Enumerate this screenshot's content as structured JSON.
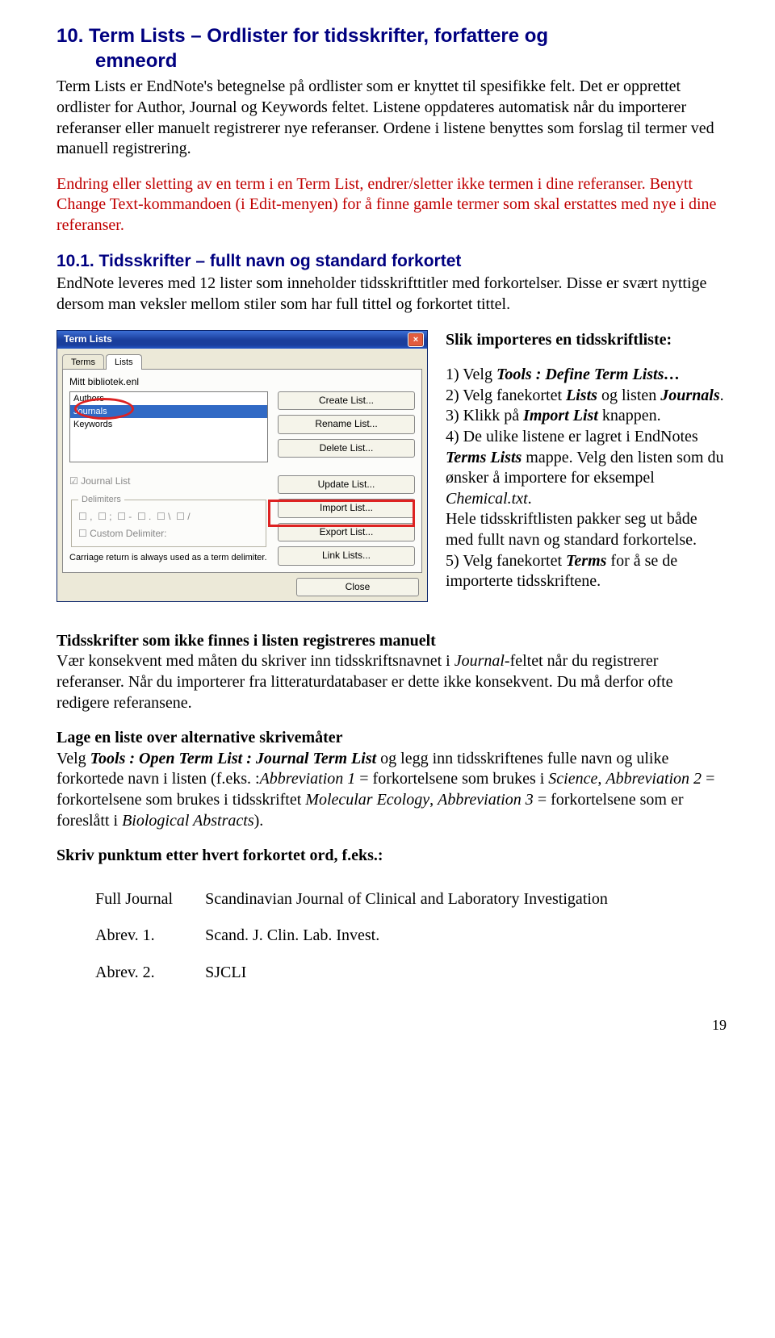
{
  "h1_line1": "10. Term Lists – Ordlister for tidsskrifter, forfattere og",
  "h1_line2": "emneord",
  "para_intro": "Term Lists er EndNote's betegnelse på ordlister som er knyttet til spesifikke felt. Det er opprettet ordlister for Author, Journal og Keywords feltet. Listene oppdateres automatisk når du importerer referanser eller manuelt registrerer nye referanser. Ordene i listene benyttes som forslag til termer ved manuell registrering.",
  "para_red": "Endring eller sletting av en term i en Term List, endrer/sletter ikke termen i dine referanser. Benytt Change Text-kommandoen (i Edit-menyen) for å finne gamle termer som skal erstattes med nye i dine referanser.",
  "h2": "10.1. Tidsskrifter – fullt navn og standard forkortet",
  "para_101": "EndNote leveres med 12 lister som inneholder tidsskrifttitler med forkortelser. Disse er svært nyttige dersom man veksler mellom stiler som har full tittel og forkortet tittel.",
  "right_heading": "Slik importeres en tidsskriftliste:",
  "step1a": "1) Velg ",
  "step1b": "Tools : Define Term Lists…",
  "step2a": "2) Velg fanekortet ",
  "step2b": "Lists",
  "step2c": " og listen ",
  "step2d": "Journals",
  "step2e": ".",
  "step3a": "3) Klikk på ",
  "step3b": "Import List",
  "step3c": " knappen.",
  "step4a": "4) De ulike listene er lagret i EndNotes ",
  "step4b": "Terms Lists",
  "step4c": " mappe. Velg den listen som du ønsker å importere for eksempel ",
  "step4d": "Chemical.txt",
  "step4e": ".",
  "step4f": "Hele tidsskriftlisten pakker seg ut både med fullt navn og standard forkortelse.",
  "step5a": "5) Velg fanekortet ",
  "step5b": "Terms",
  "step5c": " for å se de importerte tidsskriftene.",
  "manuell_h": "Tidsskrifter som ikke finnes i listen registreres manuelt",
  "manuell_p1": "Vær konsekvent med måten du skriver inn tidsskriftsnavnet i ",
  "manuell_p1b": "Journal",
  "manuell_p1c": "-feltet når du registrerer referanser. Når du importerer fra litteraturdatabaser er dette ikke konsekvent. Du må derfor ofte redigere referansene.",
  "alt_h": "Lage en liste over alternative skrivemåter",
  "alt_p1a": "Velg ",
  "alt_p1b": "Tools : Open Term List : Journal Term List",
  "alt_p1c": " og legg inn tidsskriftenes fulle navn og ulike forkortede navn i listen (f.eks. :",
  "alt_p1d": "Abbreviation 1",
  "alt_p1e": " = forkortelsene som brukes i ",
  "alt_p1f": "Science",
  "alt_p1g": ",  ",
  "alt_p1h": "Abbreviation 2",
  "alt_p1i": " = forkortelsene som brukes i tidsskriftet ",
  "alt_p1j": "Molecular Ecology",
  "alt_p1k": ",  ",
  "alt_p1l": "Abbreviation 3",
  "alt_p1m": " = forkortelsene som er foreslått i ",
  "alt_p1n": "Biological Abstracts",
  "alt_p1o": ").",
  "punktum_h": "Skriv punktum etter hvert forkortet ord, f.eks.:",
  "tbl": {
    "r1a": "Full Journal",
    "r1b": "Scandinavian Journal of Clinical and Laboratory Investigation",
    "r2a": "Abrev. 1.",
    "r2b": "Scand. J. Clin. Lab. Invest.",
    "r3a": "Abrev. 2.",
    "r3b": "SJCLI"
  },
  "pagenum": "19",
  "dialog": {
    "title": "Term Lists",
    "tab_terms": "Terms",
    "tab_lists": "Lists",
    "libname": "Mitt bibliotek.enl",
    "items": {
      "a": "Authors",
      "b": "Journals",
      "c": "Keywords"
    },
    "btn_create": "Create List...",
    "btn_rename": "Rename List...",
    "btn_delete": "Delete List...",
    "btn_update": "Update List...",
    "btn_import": "Import List...",
    "btn_export": "Export List...",
    "btn_link": "Link Lists...",
    "btn_close": "Close",
    "jlist": "Journal List",
    "delim": "Delimiters",
    "custom": "Custom Delimiter:",
    "carriage": "Carriage return is always used as a term delimiter."
  }
}
